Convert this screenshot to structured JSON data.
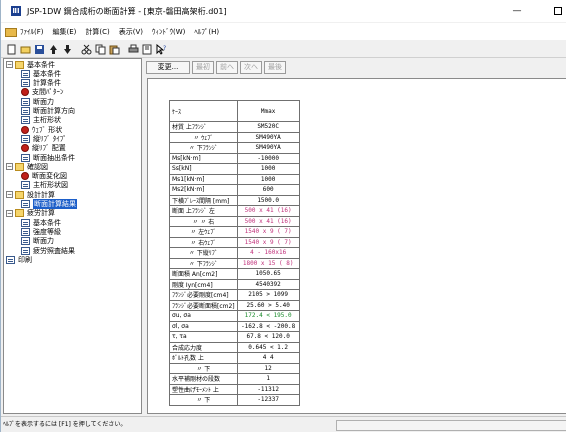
{
  "window": {
    "title": "JSP-1DW 鋼合成桁の断面計算 - [東京-磐田高架桁.d01]",
    "app_icon": "ⅡⅠ"
  },
  "menu": [
    "ﾌｧｲﾙ(F)",
    "編集(E)",
    "計算(C)",
    "表示(V)",
    "ｳｨﾝﾄﾞｳ(W)",
    "ﾍﾙﾌﾟ(H)"
  ],
  "toolbar": {
    "icons": [
      "new-file-icon",
      "open-folder-icon",
      "save-icon",
      "arrow-up-icon",
      "arrow-down-icon",
      "cut-icon",
      "copy-icon",
      "paste-icon",
      "print-icon",
      "print-preview-icon",
      "help-icon"
    ],
    "glyphs": [
      "□",
      "▭",
      "■",
      "↑",
      "↓",
      "✂",
      "⎘",
      "▤",
      "⎙",
      "?",
      "?"
    ]
  },
  "tree": [
    {
      "label": "基本条件",
      "level": 0,
      "expander": "−",
      "icon": "folder"
    },
    {
      "label": "基本条件",
      "level": 1,
      "icon": "doc"
    },
    {
      "label": "計算条件",
      "level": 1,
      "icon": "doc"
    },
    {
      "label": "支間ﾊﾟﾀｰﾝ",
      "level": 1,
      "icon": "red"
    },
    {
      "label": "断面力",
      "level": 1,
      "icon": "doc"
    },
    {
      "label": "断面計算方向",
      "level": 1,
      "icon": "doc"
    },
    {
      "label": "主桁形状",
      "level": 1,
      "icon": "doc"
    },
    {
      "label": "ｳｪﾌﾞ 形状",
      "level": 1,
      "icon": "red"
    },
    {
      "label": "縦ﾘﾌﾞ ﾀｲﾌﾟ",
      "level": 1,
      "icon": "doc"
    },
    {
      "label": "縦ﾘﾌﾞ 配置",
      "level": 1,
      "icon": "red"
    },
    {
      "label": "断面抽出条件",
      "level": 1,
      "icon": "doc"
    },
    {
      "label": "確認図",
      "level": 0,
      "expander": "−",
      "icon": "folder"
    },
    {
      "label": "断面変化図",
      "level": 1,
      "icon": "red"
    },
    {
      "label": "主桁形状図",
      "level": 1,
      "icon": "doc"
    },
    {
      "label": "設計計算",
      "level": 0,
      "expander": "−",
      "icon": "folder"
    },
    {
      "label": "断面計算結果",
      "level": 1,
      "icon": "doc",
      "selected": true
    },
    {
      "label": "疲労計算",
      "level": 0,
      "expander": "−",
      "icon": "folder"
    },
    {
      "label": "基本条件",
      "level": 1,
      "icon": "doc"
    },
    {
      "label": "強度等級",
      "level": 1,
      "icon": "doc"
    },
    {
      "label": "断面力",
      "level": 1,
      "icon": "doc"
    },
    {
      "label": "疲労照査結果",
      "level": 1,
      "icon": "doc"
    },
    {
      "label": "印刷",
      "level": 0,
      "icon": "doc"
    }
  ],
  "panel_buttons": [
    {
      "label": "変更...",
      "enabled": true
    },
    {
      "label": "最初",
      "enabled": false
    },
    {
      "label": "前へ",
      "enabled": false
    },
    {
      "label": "次へ",
      "enabled": false
    },
    {
      "label": "最後",
      "enabled": false
    }
  ],
  "table": {
    "header": [
      "ｹｰｽ",
      "Mmax"
    ],
    "rows": [
      {
        "label": "材質 上ﾌﾗﾝｼﾞ",
        "value": "SM520C"
      },
      {
        "label": "〃 ｳｪﾌﾞ",
        "value": "SM490YA",
        "indent": true
      },
      {
        "label": "〃 下ﾌﾗﾝｼﾞ",
        "value": "SM490YA",
        "indent": true
      },
      {
        "label": "Ms[kN·m]",
        "value": "-10000"
      },
      {
        "label": "Ss[kN]",
        "value": "1000"
      },
      {
        "label": "Ms1[kN·m]",
        "value": "1000"
      },
      {
        "label": "Ms2[kN·m]",
        "value": "600"
      },
      {
        "label": "下横ﾌﾞﾚｰｽ間隔 [mm]",
        "value": "1500.0"
      },
      {
        "label": "断面 上ﾌﾗﾝｼﾞ 左",
        "value": "500 x 41 (16)",
        "color": "pink"
      },
      {
        "label": "〃 〃 右",
        "value": "500 x 41 (16)",
        "color": "pink",
        "indent": true
      },
      {
        "label": "〃 左ｳｪﾌﾞ",
        "value": "1540 x 9 ( 7)",
        "color": "pink",
        "indent": true
      },
      {
        "label": "〃 右ｳｪﾌﾞ",
        "value": "1540 x 9 ( 7)",
        "color": "pink",
        "indent": true
      },
      {
        "label": "〃 下縦ﾘﾌﾞ",
        "value": "4 - 160x16",
        "color": "pink",
        "indent": true
      },
      {
        "label": "〃 下ﾌﾗﾝｼﾞ",
        "value": "1800 x 15 ( 8)",
        "color": "pink",
        "indent": true
      },
      {
        "label": "断面積 An[cm2]",
        "value": "1050.65"
      },
      {
        "label": "剛度 Iyn[cm4]",
        "value": "4540392"
      },
      {
        "label": "ﾌﾗﾝｼﾞ必要剛度[cm4]",
        "value": "2105 > 1099"
      },
      {
        "label": "ﾌﾗﾝｼﾞ必要断面積[cm2]",
        "value": "25.60 > 5.40"
      },
      {
        "label": "σu, σa",
        "value": "172.4 < 195.0",
        "color": "green"
      },
      {
        "label": "σl, σa",
        "value": "-162.8 < -200.8"
      },
      {
        "label": "τ, τa",
        "value": "67.8 < 120.0"
      },
      {
        "label": "合成応力度",
        "value": "0.645 < 1.2"
      },
      {
        "label": "ﾎﾞﾙﾄ孔数 上",
        "value": "4 4"
      },
      {
        "label": "〃 下",
        "value": "12",
        "indent": true
      },
      {
        "label": "水平補剛材の段数",
        "value": "1"
      },
      {
        "label": "塑性曲げﾓｰﾒﾝﾄ 上",
        "value": "-11312"
      },
      {
        "label": "〃 下",
        "value": "-12337",
        "indent": true
      }
    ]
  },
  "status": {
    "text": "ﾍﾙﾌﾟを表示するには [F1] を押してください。"
  }
}
